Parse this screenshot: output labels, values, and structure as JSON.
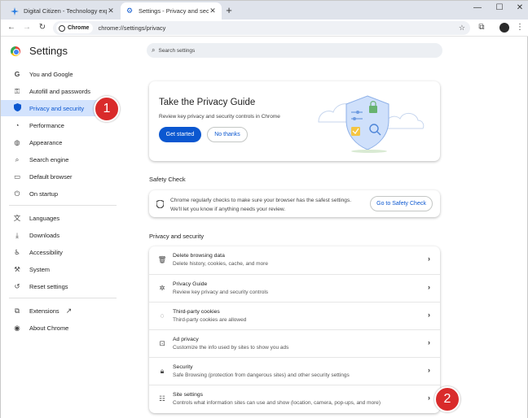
{
  "browser": {
    "tabs": [
      {
        "title": "Digital Citizen - Technology exp",
        "active": false
      },
      {
        "title": "Settings - Privacy and security",
        "active": true
      }
    ],
    "new_tab_label": "+",
    "window_controls": {
      "minimize": "—",
      "maximize": "☐",
      "close": "✕"
    },
    "address_chip": "Chrome",
    "url": "chrome://settings/privacy"
  },
  "settings": {
    "title": "Settings",
    "search_placeholder": "Search settings",
    "nav": [
      {
        "label": "You and Google",
        "icon": "google-g-icon"
      },
      {
        "label": "Autofill and passwords",
        "icon": "key-icon"
      },
      {
        "label": "Privacy and security",
        "icon": "shield-icon",
        "active": true
      },
      {
        "label": "Performance",
        "icon": "speedometer-icon"
      },
      {
        "label": "Appearance",
        "icon": "palette-icon"
      },
      {
        "label": "Search engine",
        "icon": "search-icon"
      },
      {
        "label": "Default browser",
        "icon": "browser-window-icon"
      },
      {
        "label": "On startup",
        "icon": "power-icon"
      },
      {
        "label": "Languages",
        "icon": "translate-icon"
      },
      {
        "label": "Downloads",
        "icon": "download-icon"
      },
      {
        "label": "Accessibility",
        "icon": "accessibility-icon"
      },
      {
        "label": "System",
        "icon": "wrench-icon"
      },
      {
        "label": "Reset settings",
        "icon": "reset-icon"
      },
      {
        "label": "Extensions",
        "icon": "puzzle-icon"
      },
      {
        "label": "About Chrome",
        "icon": "chrome-logo-icon"
      }
    ],
    "privacy_guide": {
      "title": "Take the Privacy Guide",
      "description": "Review key privacy and security controls in Chrome",
      "primary_button": "Get started",
      "secondary_button": "No thanks"
    },
    "safety_check": {
      "heading": "Safety Check",
      "line1": "Chrome regularly checks to make sure your browser has the safest settings.",
      "line2": "We'll let you know if anything needs your review.",
      "button": "Go to Safety Check"
    },
    "privacy_section": {
      "heading": "Privacy and security",
      "rows": [
        {
          "label": "Delete browsing data",
          "description": "Delete history, cookies, cache, and more",
          "icon": "trash-icon"
        },
        {
          "label": "Privacy Guide",
          "description": "Review key privacy and security controls",
          "icon": "privacy-guide-icon"
        },
        {
          "label": "Third-party cookies",
          "description": "Third-party cookies are allowed",
          "icon": "cookie-icon"
        },
        {
          "label": "Ad privacy",
          "description": "Customize the info used by sites to show you ads",
          "icon": "ad-privacy-icon"
        },
        {
          "label": "Security",
          "description": "Safe Browsing (protection from dangerous sites) and other security settings",
          "icon": "lock-icon"
        },
        {
          "label": "Site settings",
          "description": "Controls what information sites can use and show (location, camera, pop-ups, and more)",
          "icon": "sliders-icon"
        }
      ]
    }
  },
  "annotations": {
    "badge1": "1",
    "badge2": "2",
    "color": "#d92b2b"
  },
  "colors": {
    "accent": "#0b57d0",
    "active_nav_bg": "#d3e3fd"
  }
}
